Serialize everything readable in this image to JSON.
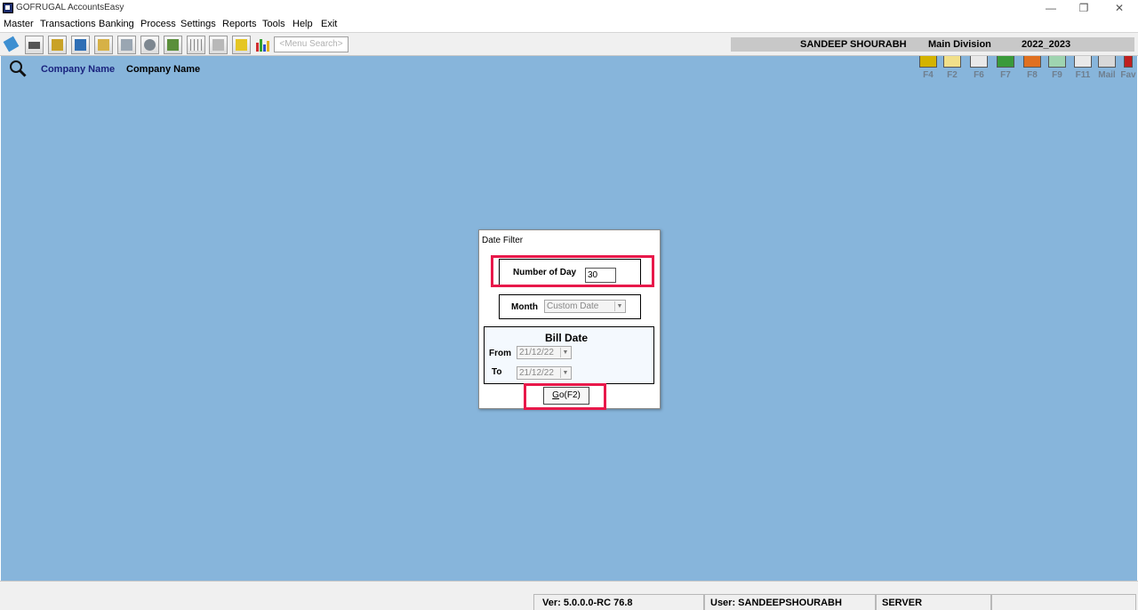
{
  "window": {
    "title": "GOFRUGAL AccountsEasy",
    "minimize": "—",
    "restore": "❐",
    "close": "✕"
  },
  "menu": {
    "items": [
      "Master",
      "Transactions",
      "Banking",
      "Process",
      "Settings",
      "Reports",
      "Tools",
      "Help",
      "Exit"
    ]
  },
  "toolbar": {
    "search_placeholder": "<Menu Search>",
    "user_name": "SANDEEP SHOURABH",
    "division": "Main Division",
    "year": "2022_2023",
    "icons": [
      "book-icon",
      "printer-icon",
      "box-icon",
      "ledger-icon",
      "folder-icon",
      "document-icon",
      "gear-document-icon",
      "checklist-icon",
      "grid-icon",
      "calculator-icon",
      "exit-icon",
      "bar-chart-icon"
    ]
  },
  "workspace": {
    "company_label_1": "Company Name",
    "company_label_2": "Company Name",
    "fkeys": [
      "F4",
      "F2",
      "F6",
      "F7",
      "F8",
      "F9",
      "F11",
      "Mail",
      "Fav"
    ]
  },
  "dialog": {
    "title": "Date Filter",
    "number_of_day_label": "Number of Day",
    "number_of_day_value": "30",
    "month_label": "Month",
    "month_value": "Custom Date",
    "bill_date_label": "Bill Date",
    "from_label": "From",
    "from_value": "21/12/22",
    "to_label": "To",
    "to_value": "21/12/22",
    "go_button_prefix": "G",
    "go_button_rest": "o(F2)"
  },
  "statusbar": {
    "version": "Ver: 5.0.0.0-RC 76.8",
    "user": "User: SANDEEPSHOURABH",
    "server": "SERVER"
  },
  "colors": {
    "workspace_bg": "#87b5db",
    "highlight": "#e8184a",
    "company_label_1": "#1a237e"
  }
}
